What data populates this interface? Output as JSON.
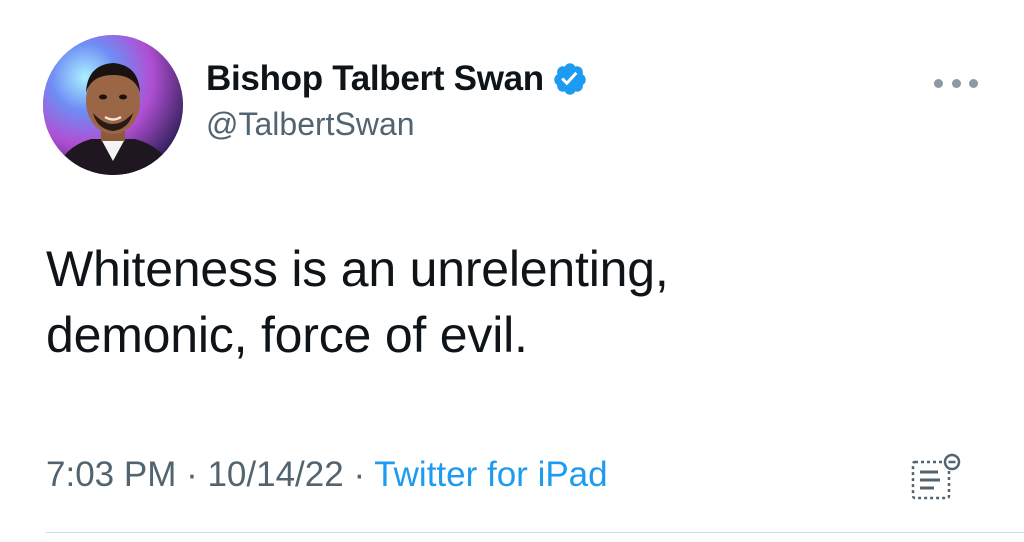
{
  "author": {
    "display_name": "Bishop Talbert Swan",
    "handle": "@TalbertSwan",
    "verified": true
  },
  "tweet": {
    "text_line_1": "Whiteness is an unrelenting,",
    "text_line_2": "demonic, force of evil."
  },
  "meta": {
    "time": "7:03 PM",
    "separator_1": " · ",
    "date": "10/14/22",
    "separator_2": " · ",
    "source": "Twitter for iPad"
  },
  "icons": {
    "more": "more-horizontal-icon",
    "verified": "verified-badge-icon",
    "analytics": "analytics-icon"
  },
  "colors": {
    "accent": "#1d9bf0",
    "secondary_text": "#536471",
    "primary_text": "#0f1419"
  }
}
